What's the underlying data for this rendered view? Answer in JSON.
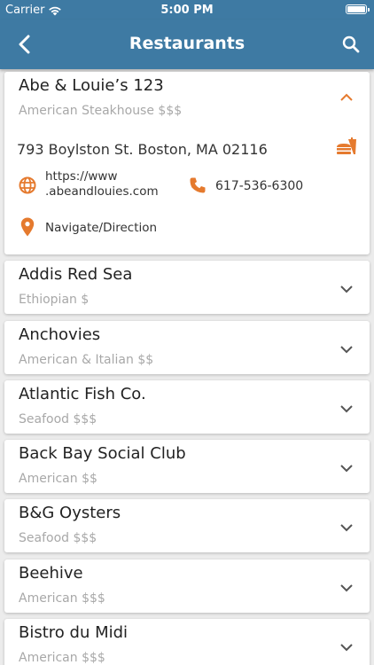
{
  "status_bar": {
    "carrier": "Carrier",
    "time": "5:00 PM"
  },
  "nav": {
    "title": "Restaurants"
  },
  "colors": {
    "header": "#3e7aa3",
    "accent": "#e57a2e",
    "background": "#ececec"
  },
  "expanded": {
    "name": "Abe & Louie’s 123",
    "cuisine": "American Steakhouse $$$",
    "address": "793 Boylston St. Boston, MA 02116",
    "website_line1": "https://www",
    "website_line2": ".abeandlouies.com",
    "phone": "617-536-6300",
    "navigate": "Navigate/Direction"
  },
  "restaurants": [
    {
      "name": "Addis Red Sea",
      "cuisine": "Ethiopian $"
    },
    {
      "name": "Anchovies",
      "cuisine": "American & Italian $$"
    },
    {
      "name": "Atlantic Fish Co.",
      "cuisine": "Seafood $$$"
    },
    {
      "name": "Back Bay Social Club",
      "cuisine": "American $$"
    },
    {
      "name": "B&G Oysters",
      "cuisine": "Seafood $$$"
    },
    {
      "name": "Beehive",
      "cuisine": "American $$$"
    },
    {
      "name": "Bistro du Midi",
      "cuisine": "American $$$"
    }
  ],
  "icons": {
    "back": "chevron-left-icon",
    "search": "search-icon",
    "collapse": "chevron-up-icon",
    "expand": "chevron-down-icon",
    "food": "fast-food-icon",
    "web": "globe-icon",
    "phone": "phone-icon",
    "navigate": "location-pin-icon"
  }
}
